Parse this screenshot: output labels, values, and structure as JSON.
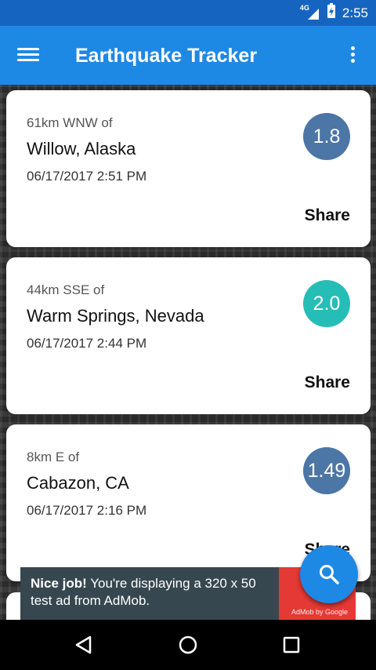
{
  "status_bar": {
    "network": "4G",
    "time": "2:55"
  },
  "app_bar": {
    "title": "Earthquake Tracker",
    "menu_icon": "menu-icon",
    "overflow_icon": "more-vert-icon"
  },
  "quakes": [
    {
      "distance": "61km WNW of",
      "place": "Willow, Alaska",
      "time": "06/17/2017 2:51 PM",
      "magnitude": "1.8",
      "share_label": "Share",
      "color": "#4B76A6"
    },
    {
      "distance": "44km SSE of",
      "place": "Warm Springs, Nevada",
      "time": "06/17/2017 2:44 PM",
      "magnitude": "2.0",
      "share_label": "Share",
      "color": "#26BDB7"
    },
    {
      "distance": "8km E of",
      "place": "Cabazon, CA",
      "time": "06/17/2017 2:16 PM",
      "magnitude": "1.49",
      "share_label": "Share",
      "color": "#4B76A6"
    }
  ],
  "ad": {
    "headline": "Nice job!",
    "text": "You're displaying a 320 x 50 test ad from AdMob.",
    "brand": "AdMob by Google"
  },
  "fab": {
    "icon": "search-icon"
  },
  "colors": {
    "status_bar": "#1565C0",
    "app_bar": "#1E88E5",
    "fab": "#1E88E5",
    "ad_background": "#37474F",
    "ad_image": "#E53935"
  }
}
